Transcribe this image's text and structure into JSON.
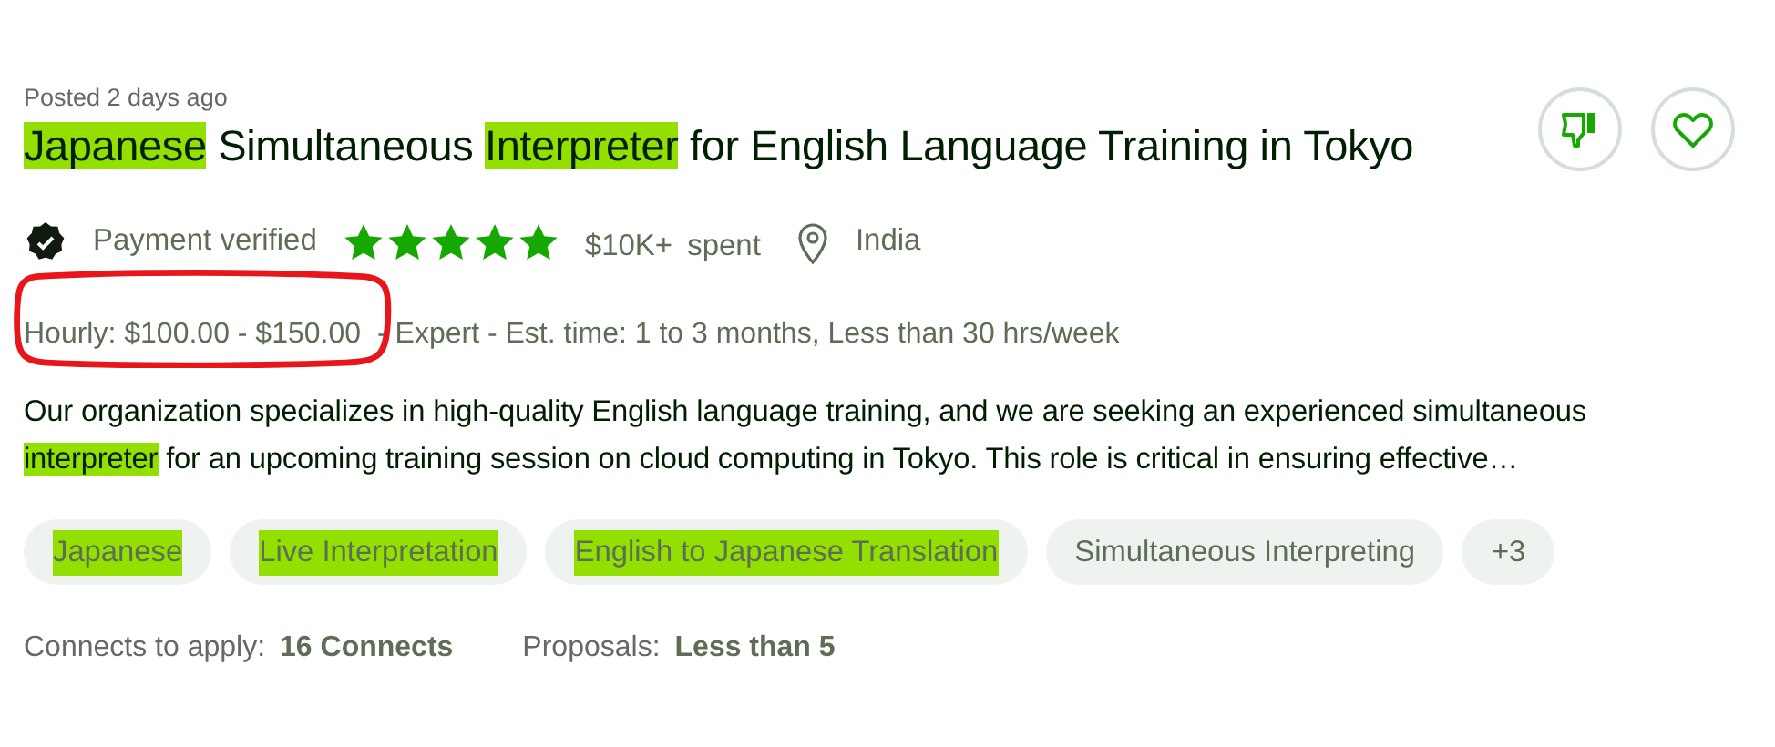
{
  "posted": "Posted 2 days ago",
  "title": [
    {
      "text": "Japanese",
      "highlighted": true
    },
    {
      "text": " Simultaneous ",
      "highlighted": false
    },
    {
      "text": "Interpreter",
      "highlighted": true
    },
    {
      "text": " for English Language Training in Tokyo",
      "highlighted": false
    }
  ],
  "actions": [
    {
      "kind": "dislike"
    },
    {
      "kind": "save"
    }
  ],
  "client": {
    "payment_verified": true,
    "payment_label": "Payment verified",
    "stars": 5,
    "spent_amount": "$10K+",
    "spent_label": "spent",
    "location": "India"
  },
  "terms": {
    "rate": "Hourly: $100.00 - $150.00",
    "rate_circled": true,
    "details": "- Expert - Est. time: 1 to 3 months, Less than 30 hrs/week"
  },
  "description": [
    {
      "text": "Our organization specializes in high-quality English language training, and we are seeking an experienced simultaneous ",
      "highlighted": false
    },
    {
      "text": "interpreter",
      "highlighted": true
    },
    {
      "text": " for an upcoming training session on cloud computing in Tokyo. This role is critical in ensuring effective…",
      "highlighted": false
    }
  ],
  "tags": [
    {
      "label": "Japanese",
      "highlighted": true
    },
    {
      "label": "Live Interpretation",
      "highlighted": true
    },
    {
      "label": "English to Japanese Translation",
      "highlighted": true
    },
    {
      "label": "Simultaneous Interpreting",
      "highlighted": false
    },
    {
      "label": "+3",
      "highlighted": false
    }
  ],
  "footer": [
    {
      "label": "Connects to apply:",
      "value": "16 Connects"
    },
    {
      "label": "Proposals:",
      "value": "Less than 5"
    }
  ]
}
